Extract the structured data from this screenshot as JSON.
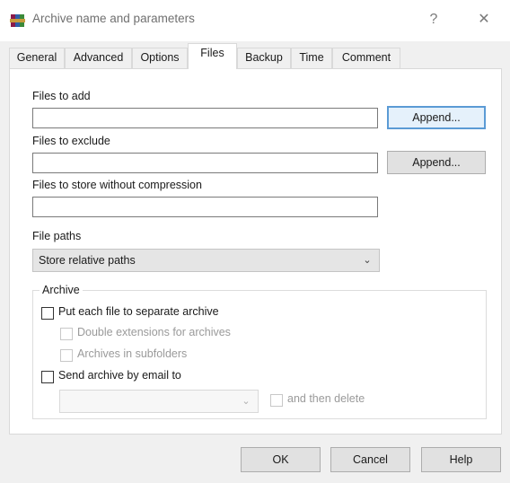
{
  "window": {
    "title": "Archive name and parameters",
    "help_glyph": "?",
    "close_glyph": "✕"
  },
  "tabs": [
    {
      "label": "General"
    },
    {
      "label": "Advanced"
    },
    {
      "label": "Options"
    },
    {
      "label": "Files",
      "active": true
    },
    {
      "label": "Backup"
    },
    {
      "label": "Time"
    },
    {
      "label": "Comment"
    }
  ],
  "files": {
    "add_label": "Files to add",
    "add_value": "",
    "add_button": "Append...",
    "exclude_label": "Files to exclude",
    "exclude_value": "",
    "exclude_button": "Append...",
    "store_label": "Files to store without compression",
    "store_value": "",
    "paths_label": "File paths",
    "paths_selected": "Store relative paths"
  },
  "archive_group": {
    "legend": "Archive",
    "separate_label": "Put each file to separate archive",
    "separate_checked": false,
    "double_ext_label": "Double extensions for archives",
    "double_ext_checked": false,
    "subfolders_label": "Archives in subfolders",
    "subfolders_checked": false,
    "email_label": "Send archive by email to",
    "email_checked": false,
    "email_value": "",
    "then_delete_label": "and then delete",
    "then_delete_checked": false
  },
  "buttons": {
    "ok": "OK",
    "cancel": "Cancel",
    "help": "Help"
  },
  "icons": {
    "app": "winrar-books-icon",
    "dropdown": "chevron-down-icon"
  },
  "colors": {
    "focus_border": "#5b9bd5",
    "title_text": "#707070"
  }
}
